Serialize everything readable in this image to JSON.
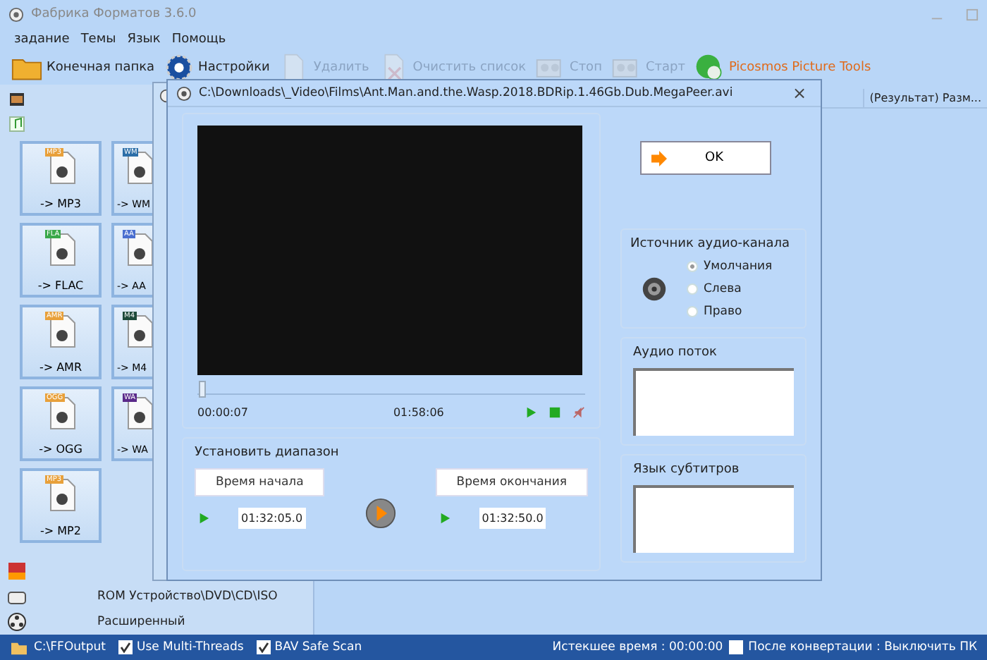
{
  "window": {
    "title": "Фабрика Форматов 3.6.0"
  },
  "menu": [
    "задание",
    "Темы",
    "Язык",
    "Помощь"
  ],
  "toolbar": [
    {
      "label": "Конечная папка",
      "kind": "folder",
      "disabled": false
    },
    {
      "label": "Настройки",
      "kind": "settings",
      "disabled": false
    },
    {
      "label": "Удалить",
      "kind": "delete",
      "disabled": true
    },
    {
      "label": "Очистить список",
      "kind": "clear",
      "disabled": true
    },
    {
      "label": "Стоп",
      "kind": "stop",
      "disabled": true
    },
    {
      "label": "Старт",
      "kind": "start",
      "disabled": true
    },
    {
      "label": "Picosmos Picture Tools",
      "kind": "globe",
      "disabled": false
    }
  ],
  "formats": [
    {
      "tag": "MP3",
      "label": "-> MP3",
      "color": "#e8a03a"
    },
    {
      "tag": "WM",
      "label": "-> WM",
      "color": "#2d6fa8"
    },
    {
      "tag": "FLA",
      "label": "-> FLAC",
      "color": "#3aa84a"
    },
    {
      "tag": "AA",
      "label": "-> AA",
      "color": "#4a6fd0"
    },
    {
      "tag": "AMR",
      "label": "-> AMR",
      "color": "#e8a03a"
    },
    {
      "tag": "M4",
      "label": "-> M4",
      "color": "#1d4a3a"
    },
    {
      "tag": "OGG",
      "label": "-> OGG",
      "color": "#e8a03a"
    },
    {
      "tag": "WA",
      "label": "-> WA",
      "color": "#5a2a8a"
    },
    {
      "tag": "MP3",
      "label": "-> MP2",
      "color": "#e8a03a"
    }
  ],
  "sidebar_bottom": [
    {
      "label": "ROM Устройство\\DVD\\CD\\ISO"
    },
    {
      "label": "Расширенный"
    }
  ],
  "table": {
    "columns": [
      "(Результат) Разм..."
    ]
  },
  "dialog": {
    "title": "C:\\Downloads\\_Video\\Films\\Ant.Man.and.the.Wasp.2018.BDRip.1.46Gb.Dub.MegaPeer.avi",
    "close": "×",
    "player": {
      "level": 0.002,
      "current": "00:00:07",
      "total": "01:58:06"
    },
    "range": {
      "title": "Установить диапазон",
      "start_button": "Время начала",
      "end_button": "Время окончания",
      "start_value": "01:32:05.0",
      "end_value": "01:32:50.0"
    },
    "ok": "OK",
    "audio_source": {
      "title": "Источник аудио-канала",
      "options": [
        {
          "label": "Умолчания",
          "selected": true
        },
        {
          "label": "Слева",
          "selected": false
        },
        {
          "label": "Право",
          "selected": false
        }
      ]
    },
    "audio_stream": {
      "title": "Аудио поток"
    },
    "subtitles": {
      "title": "Язык субтитров"
    }
  },
  "status_bar": {
    "folder": "C:\\FFOutput",
    "options": [
      {
        "label": "Use Multi-Threads",
        "checked": true
      },
      {
        "label": "BAV Safe Scan",
        "checked": true
      }
    ],
    "elapsed": "Истекшее время : 00:00:00",
    "shutdown": {
      "label": "После конвертации : Выключить ПК",
      "checked": false
    }
  }
}
